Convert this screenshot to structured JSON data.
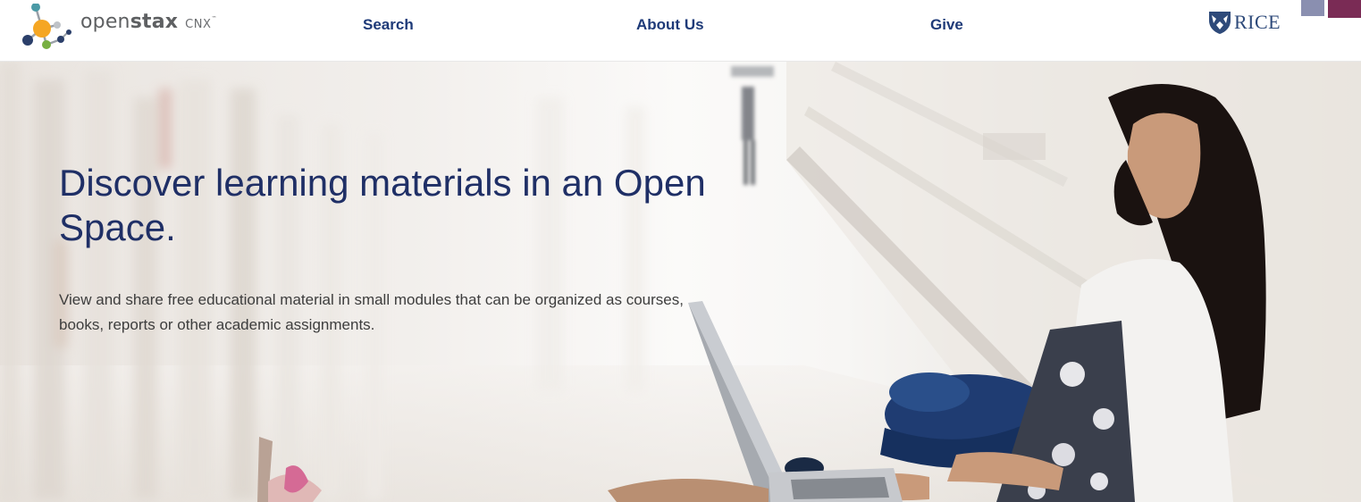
{
  "header": {
    "logo": {
      "brand_light": "open",
      "brand_bold": "stax",
      "product": "CNX",
      "trademark": "™"
    },
    "nav": {
      "search": "Search",
      "about": "About Us",
      "give": "Give"
    },
    "partner": {
      "name": "RICE"
    }
  },
  "hero": {
    "title": "Discover learning materials in an Open Space.",
    "description": "View and share free educational material in small modules that can be organized as courses, books, reports or other academic assignments."
  },
  "colors": {
    "nav_text": "#1e3a78",
    "hero_title": "#1f2f66",
    "hero_text": "#3d3d3d",
    "logo_text": "#5e6062",
    "logo_orange": "#f5a623",
    "logo_green": "#78b042",
    "logo_navy": "#2b3f6a",
    "logo_teal": "#4b9aa6",
    "rice_blue": "#2e4a7a"
  }
}
